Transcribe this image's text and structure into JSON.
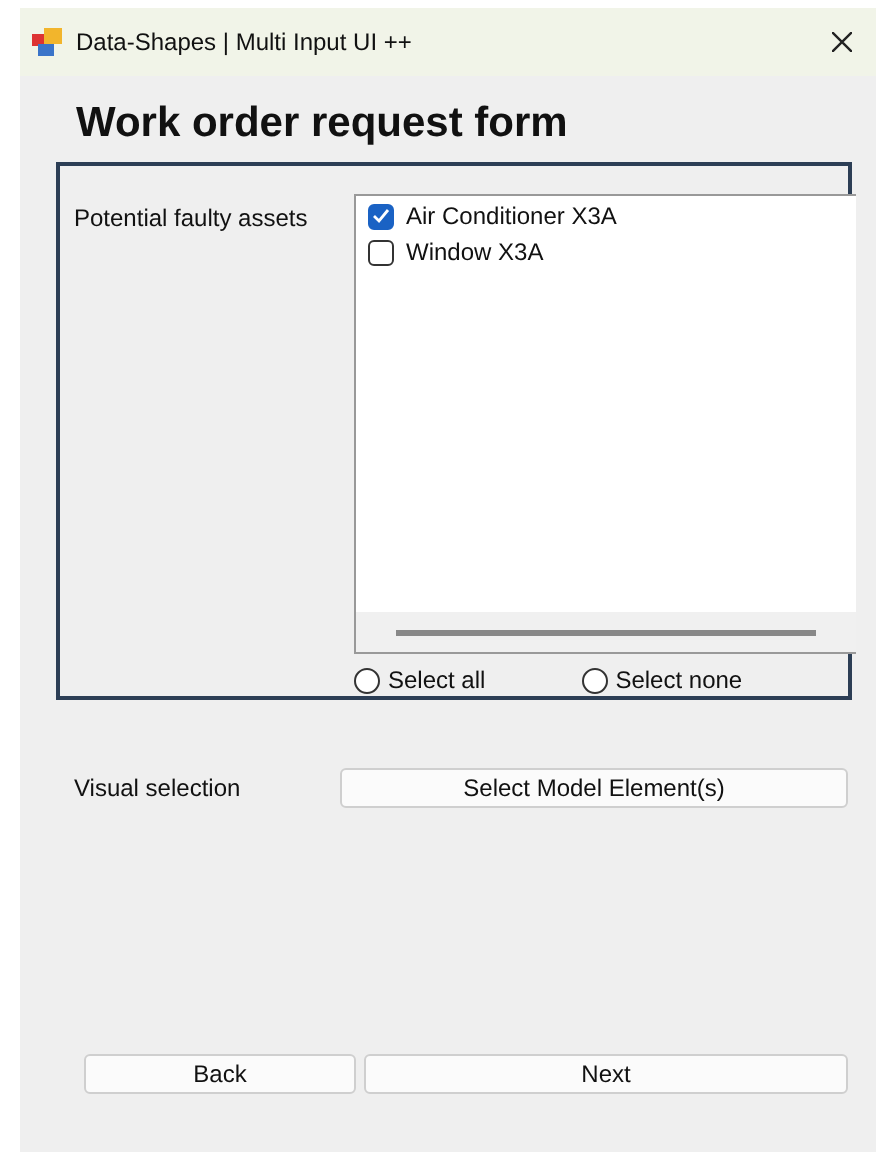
{
  "window": {
    "title": "Data-Shapes | Multi Input UI ++"
  },
  "heading": "Work order request form",
  "assets": {
    "label": "Potential faulty assets",
    "items": [
      {
        "label": "Air Conditioner X3A",
        "checked": true
      },
      {
        "label": "Window X3A",
        "checked": false
      }
    ],
    "options": [
      {
        "label": "Select all",
        "selected": false
      },
      {
        "label": "Select none",
        "selected": false
      }
    ]
  },
  "visual_selection": {
    "label": "Visual selection",
    "button": "Select Model Element(s)"
  },
  "buttons": [
    "Back",
    "Next"
  ]
}
